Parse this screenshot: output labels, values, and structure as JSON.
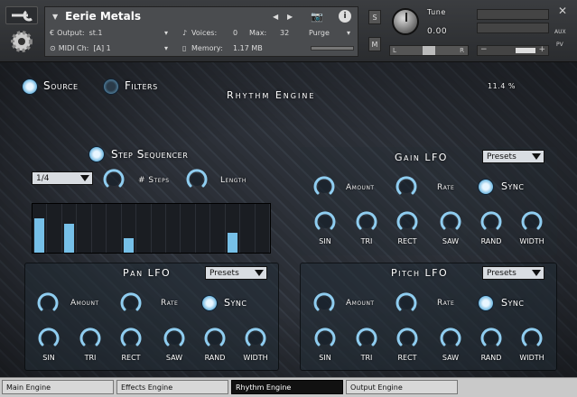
{
  "header": {
    "instrument_name": "Eerie Metals",
    "output_label": "Output:",
    "output_value": "st.1",
    "voices_label": "Voices:",
    "voices_value": "0",
    "max_label": "Max:",
    "max_value": "32",
    "purge_label": "Purge",
    "midi_label": "MIDI Ch:",
    "midi_value": "[A] 1",
    "memory_label": "Memory:",
    "memory_value": "1.17 MB",
    "s_label": "S",
    "m_label": "M",
    "tune_label": "Tune",
    "tune_value": "0.00",
    "pan_l": "L",
    "pan_r": "R",
    "aux_label": "AUX",
    "pv_label": "PV"
  },
  "nav": {
    "source_label": "Source",
    "filters_label": "Filters",
    "engine_title": "Rhythm Engine",
    "percent": "11.4 %"
  },
  "sequencer": {
    "title": "Step Sequencer",
    "rate_value": "1/4",
    "steps_label": "# Steps",
    "length_label": "Length",
    "step_levels": [
      0.7,
      0.0,
      0.6,
      0.0,
      0.0,
      0.0,
      0.3,
      0.0,
      0.0,
      0.0,
      0.0,
      0.0,
      0.0,
      0.4,
      0.0,
      0.0
    ]
  },
  "gain_lfo": {
    "title": "Gain LFO",
    "presets": "Presets",
    "amount_label": "Amount",
    "rate_label": "Rate",
    "sync_label": "Sync",
    "shapes": [
      "SIN",
      "TRI",
      "RECT",
      "SAW",
      "RAND",
      "WIDTH"
    ]
  },
  "pan_lfo": {
    "title": "Pan LFO",
    "presets": "Presets",
    "amount_label": "Amount",
    "rate_label": "Rate",
    "sync_label": "Sync",
    "shapes": [
      "SIN",
      "TRI",
      "RECT",
      "SAW",
      "RAND",
      "WIDTH"
    ]
  },
  "pitch_lfo": {
    "title": "Pitch LFO",
    "presets": "Presets",
    "amount_label": "Amount",
    "rate_label": "Rate",
    "sync_label": "Sync",
    "shapes": [
      "SIN",
      "TRI",
      "RECT",
      "SAW",
      "RAND",
      "WIDTH"
    ]
  },
  "tabs": [
    "Main Engine",
    "Effects Engine",
    "Rhythm Engine",
    "Output Engine"
  ],
  "colors": {
    "accent": "#76c0e8",
    "header": "#3b3d40",
    "tab_active": "#111111"
  }
}
